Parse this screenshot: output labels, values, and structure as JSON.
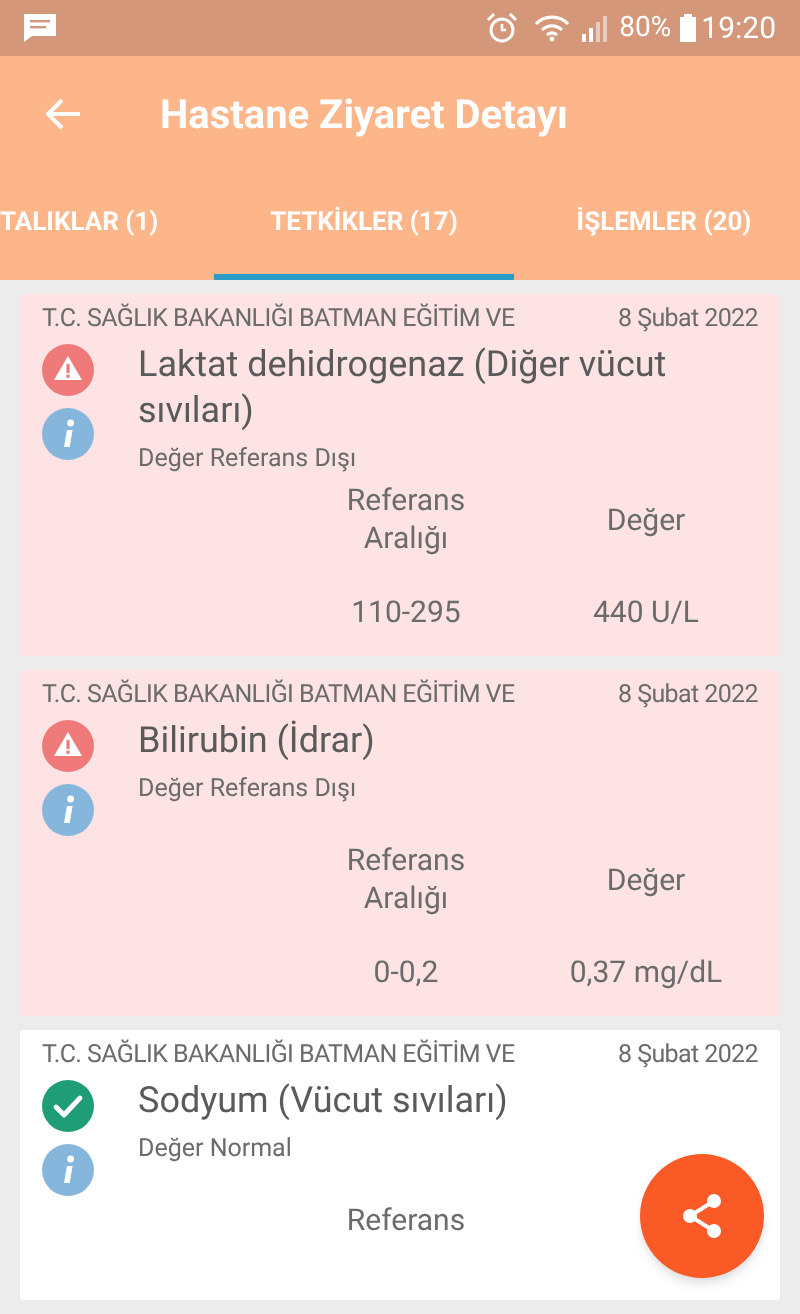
{
  "status_bar": {
    "battery": "80%",
    "time": "19:20"
  },
  "app_bar": {
    "title": "Hastane Ziyaret Detayı"
  },
  "tabs": [
    {
      "label": "TALIKLAR (1)",
      "selected": false
    },
    {
      "label": "TETKİKLER (17)",
      "selected": true
    },
    {
      "label": "İŞLEMLER (20)",
      "selected": false
    }
  ],
  "results": [
    {
      "kind": "abnormal",
      "hospital": "T.C. SAĞLIK BAKANLIĞI BATMAN EĞİTİM VE",
      "date": "8 Şubat 2022",
      "test": "Laktat dehidrogenaz (Diğer vücut sıvıları)",
      "status": "Değer Referans Dışı",
      "range_header": "Referans Aralığı",
      "value_header": "Değer",
      "range": "110-295",
      "value": "440 U/L"
    },
    {
      "kind": "abnormal",
      "hospital": "T.C. SAĞLIK BAKANLIĞI BATMAN EĞİTİM VE",
      "date": "8 Şubat 2022",
      "test": "Bilirubin (İdrar)",
      "status": "Değer Referans Dışı",
      "range_header": "Referans Aralığı",
      "value_header": "Değer",
      "range": "0-0,2",
      "value": "0,37 mg/dL"
    },
    {
      "kind": "normal",
      "hospital": "T.C. SAĞLIK BAKANLIĞI BATMAN EĞİTİM VE",
      "date": "8 Şubat 2022",
      "test": "Sodyum (Vücut sıvıları)",
      "status": "Değer Normal",
      "range_header": "Referans"
    }
  ]
}
